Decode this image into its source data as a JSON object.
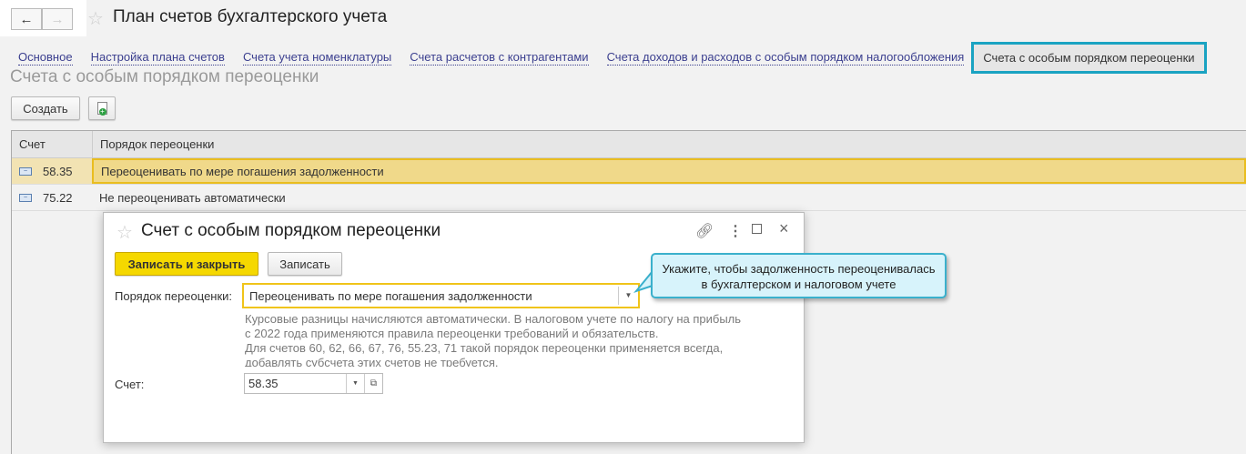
{
  "header": {
    "title": "План счетов бухгалтерского учета"
  },
  "tabs": [
    {
      "label": "Основное"
    },
    {
      "label": "Настройка плана счетов"
    },
    {
      "label": "Счета учета номенклатуры"
    },
    {
      "label": "Счета расчетов с контрагентами"
    },
    {
      "label": "Счета доходов и расходов с особым порядком налогообложения"
    },
    {
      "label": "Счета с особым порядком переоценки"
    }
  ],
  "section": {
    "title": "Счета с особым порядком переоценки",
    "create_label": "Создать"
  },
  "table": {
    "columns": [
      "Счет",
      "Порядок переоценки"
    ],
    "rows": [
      {
        "account": "58.35",
        "order": "Переоценивать по мере погашения задолженности"
      },
      {
        "account": "75.22",
        "order": "Не переоценивать автоматически"
      }
    ]
  },
  "dialog": {
    "title": "Счет с особым порядком переоценки",
    "save_close_label": "Записать и закрыть",
    "save_label": "Записать",
    "order_label": "Порядок переоценки:",
    "order_value": "Переоценивать по мере погашения задолженности",
    "description": [
      "Курсовые разницы начисляются автоматически. В налоговом учете по налогу на прибыль",
      "с 2022 года применяются правила переоценки требований и обязательств.",
      "Для счетов 60, 62, 66, 67, 76, 55.23, 71 такой порядок переоценки применяется всегда,",
      "добавлять субсчета этих счетов не требуется."
    ],
    "account_label": "Счет:",
    "account_value": "58.35"
  },
  "callout": {
    "line1": "Укажите, чтобы задолженность переоценивалась",
    "line2": "в бухгалтерском и налоговом учете"
  }
}
